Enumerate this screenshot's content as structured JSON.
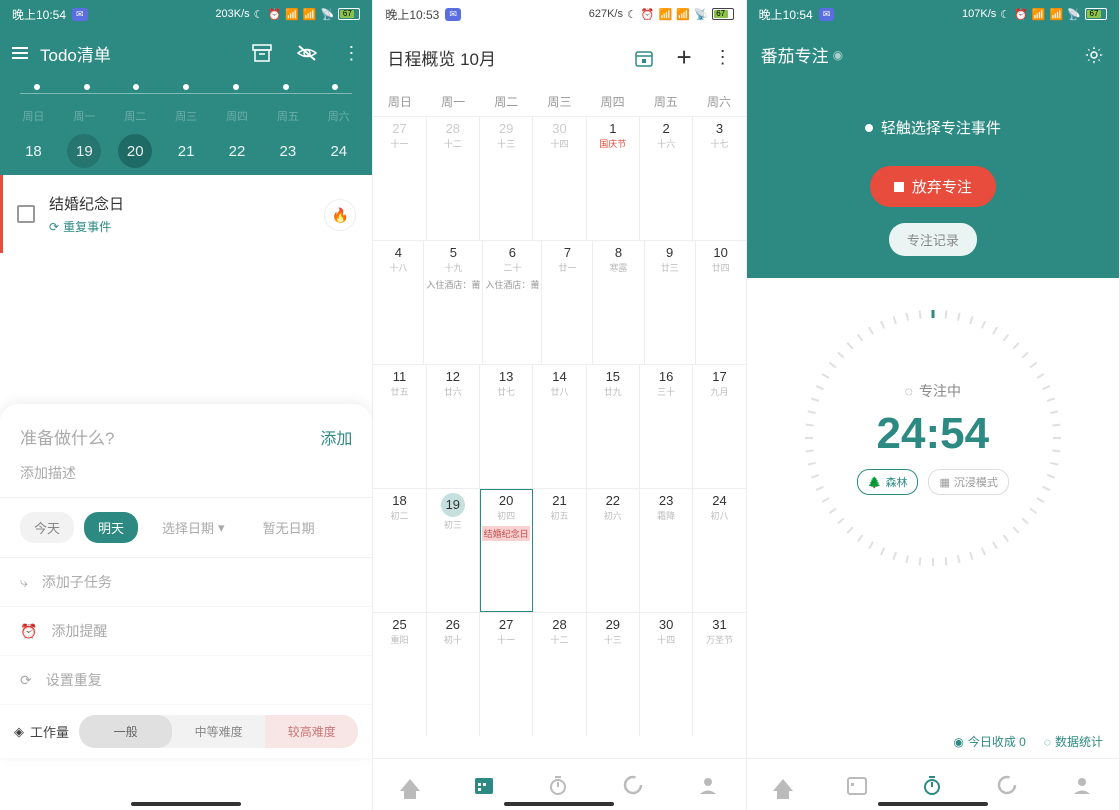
{
  "screen1": {
    "statusbar": {
      "time": "晚上10:54",
      "speed": "203K/s",
      "battery": "67"
    },
    "title": "Todo清单",
    "weekdays": [
      "周日",
      "周一",
      "周二",
      "周三",
      "周四",
      "周五",
      "周六"
    ],
    "dates": [
      "18",
      "19",
      "20",
      "21",
      "22",
      "23",
      "24"
    ],
    "task": {
      "title": "结婚纪念日",
      "repeat": "重复事件"
    },
    "sheet": {
      "placeholder": "准备做什么?",
      "add": "添加",
      "desc": "添加描述",
      "chips": {
        "today": "今天",
        "tomorrow": "明天",
        "pick": "选择日期",
        "none": "暂无日期"
      },
      "subtask": "添加子任务",
      "reminder": "添加提醒",
      "repeat": "设置重复",
      "workload_label": "工作量",
      "workload": {
        "normal": "一般",
        "medium": "中等难度",
        "high": "较高难度"
      }
    }
  },
  "screen2": {
    "statusbar": {
      "time": "晚上10:53",
      "speed": "627K/s",
      "battery": "67"
    },
    "title_prefix": "日程概览",
    "title_month": "10月",
    "weekdays": [
      "周日",
      "周一",
      "周二",
      "周三",
      "周四",
      "周五",
      "周六"
    ],
    "calendar": [
      [
        {
          "d": "27",
          "l": "十一",
          "m": true
        },
        {
          "d": "28",
          "l": "十二",
          "m": true
        },
        {
          "d": "29",
          "l": "十三",
          "m": true
        },
        {
          "d": "30",
          "l": "十四",
          "m": true
        },
        {
          "d": "1",
          "l": "国庆节",
          "h": true
        },
        {
          "d": "2",
          "l": "十六"
        },
        {
          "d": "3",
          "l": "十七"
        }
      ],
      [
        {
          "d": "4",
          "l": "十八"
        },
        {
          "d": "5",
          "l": "十九",
          "e": "入住酒店：莆"
        },
        {
          "d": "6",
          "l": "二十",
          "e": "入住酒店：莆"
        },
        {
          "d": "7",
          "l": "廿一"
        },
        {
          "d": "8",
          "l": "寒露"
        },
        {
          "d": "9",
          "l": "廿三"
        },
        {
          "d": "10",
          "l": "廿四"
        }
      ],
      [
        {
          "d": "11",
          "l": "廿五"
        },
        {
          "d": "12",
          "l": "廿六"
        },
        {
          "d": "13",
          "l": "廿七"
        },
        {
          "d": "14",
          "l": "廿八"
        },
        {
          "d": "15",
          "l": "廿九"
        },
        {
          "d": "16",
          "l": "三十"
        },
        {
          "d": "17",
          "l": "九月"
        }
      ],
      [
        {
          "d": "18",
          "l": "初二"
        },
        {
          "d": "19",
          "l": "初三",
          "today": true
        },
        {
          "d": "20",
          "l": "初四",
          "sel": true,
          "e": "结婚纪念日",
          "er": true
        },
        {
          "d": "21",
          "l": "初五"
        },
        {
          "d": "22",
          "l": "初六"
        },
        {
          "d": "23",
          "l": "霜降"
        },
        {
          "d": "24",
          "l": "初八"
        }
      ],
      [
        {
          "d": "25",
          "l": "重阳"
        },
        {
          "d": "26",
          "l": "初十"
        },
        {
          "d": "27",
          "l": "十一"
        },
        {
          "d": "28",
          "l": "十二"
        },
        {
          "d": "29",
          "l": "十三"
        },
        {
          "d": "30",
          "l": "十四"
        },
        {
          "d": "31",
          "l": "万圣节"
        }
      ]
    ]
  },
  "screen3": {
    "statusbar": {
      "time": "晚上10:54",
      "speed": "107K/s",
      "battery": "67"
    },
    "title": "番茄专注",
    "hint": "轻触选择专注事件",
    "abandon": "放弃专注",
    "record": "专注记录",
    "status": "专注中",
    "time": "24:54",
    "mode_forest": "森林",
    "mode_immerse": "沉浸模式",
    "today_harvest": "今日收成 0",
    "stats": "数据统计"
  }
}
